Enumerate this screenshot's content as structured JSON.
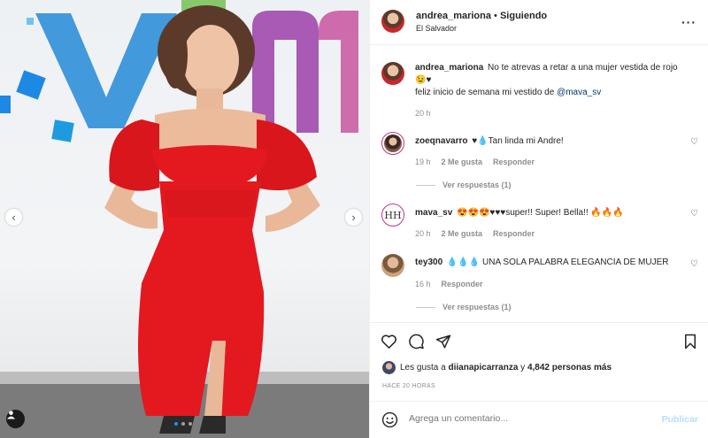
{
  "post": {
    "username": "andrea_mariona",
    "separator": "•",
    "follow_status": "Siguiendo",
    "location": "El Salvador",
    "more_icon": "more-horizontal-icon"
  },
  "caption": {
    "username": "andrea_mariona",
    "text_line1": "No te atrevas a retar a una mujer vestida de rojo 😉♥",
    "text_line2_prefix": "feliz inicio de semana mi vestido de ",
    "mention": "@mava_sv",
    "time": "20 h"
  },
  "comments": [
    {
      "username": "zoeqnavarro",
      "text": "♥💧Tan linda mi Andre!",
      "time": "19 h",
      "likes": "2 Me gusta",
      "reply": "Responder",
      "view_replies": "Ver respuestas (1)"
    },
    {
      "username": "mava_sv",
      "avatar_text": "HH",
      "text": "😍😍😍♥♥♥super!! Super! Bella!! 🔥🔥🔥",
      "time": "20 h",
      "likes": "2 Me gusta",
      "reply": "Responder"
    },
    {
      "username": "tey300",
      "text": "💧💧💧 UNA SOLA PALABRA ELEGANCIA DE MUJER",
      "time": "16 h",
      "reply": "Responder",
      "view_replies": "Ver respuestas (1)"
    }
  ],
  "likes": {
    "prefix": "Les gusta a ",
    "first_user": "diianapicarranza",
    "middle": " y ",
    "others": "4,842 personas más"
  },
  "timestamp": "HACE 20 HORAS",
  "add_comment": {
    "placeholder": "Agrega un comentario...",
    "publish_label": "Publicar"
  },
  "carousel": {
    "current": 1,
    "total": 3
  },
  "colors": {
    "dress_red": "#e3191f",
    "link": "#00376b",
    "publish_disabled": "#b2dffc",
    "story_ring": "#c13584"
  }
}
